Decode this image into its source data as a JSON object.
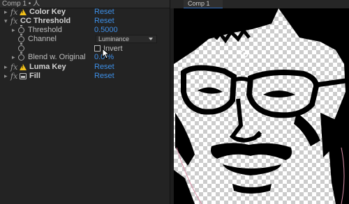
{
  "effects_panel": {
    "header": "Comp 1 • 人",
    "effects": [
      {
        "name": "Color Key",
        "reset": "Reset"
      },
      {
        "name": "CC Threshold",
        "reset": "Reset"
      },
      {
        "name": "Luma Key",
        "reset": "Reset"
      },
      {
        "name": "Fill",
        "reset": "Reset"
      }
    ],
    "threshold": {
      "label": "Threshold",
      "value": "0.5000"
    },
    "channel": {
      "label": "Channel",
      "value": "Luminance"
    },
    "invert": {
      "label": "Invert",
      "checked": false
    },
    "blend": {
      "label": "Blend w. Original",
      "value": "0.0 %"
    },
    "icons": {
      "fx": "fx",
      "warning": "warning-icon",
      "fill": "fill-icon",
      "stopwatch": "stopwatch-icon"
    }
  },
  "comp_panel": {
    "tab_label": "Comp 1",
    "accent": "#2e6fc4"
  },
  "colors": {
    "link": "#3d8fe6",
    "warning": "#f2c11a"
  }
}
